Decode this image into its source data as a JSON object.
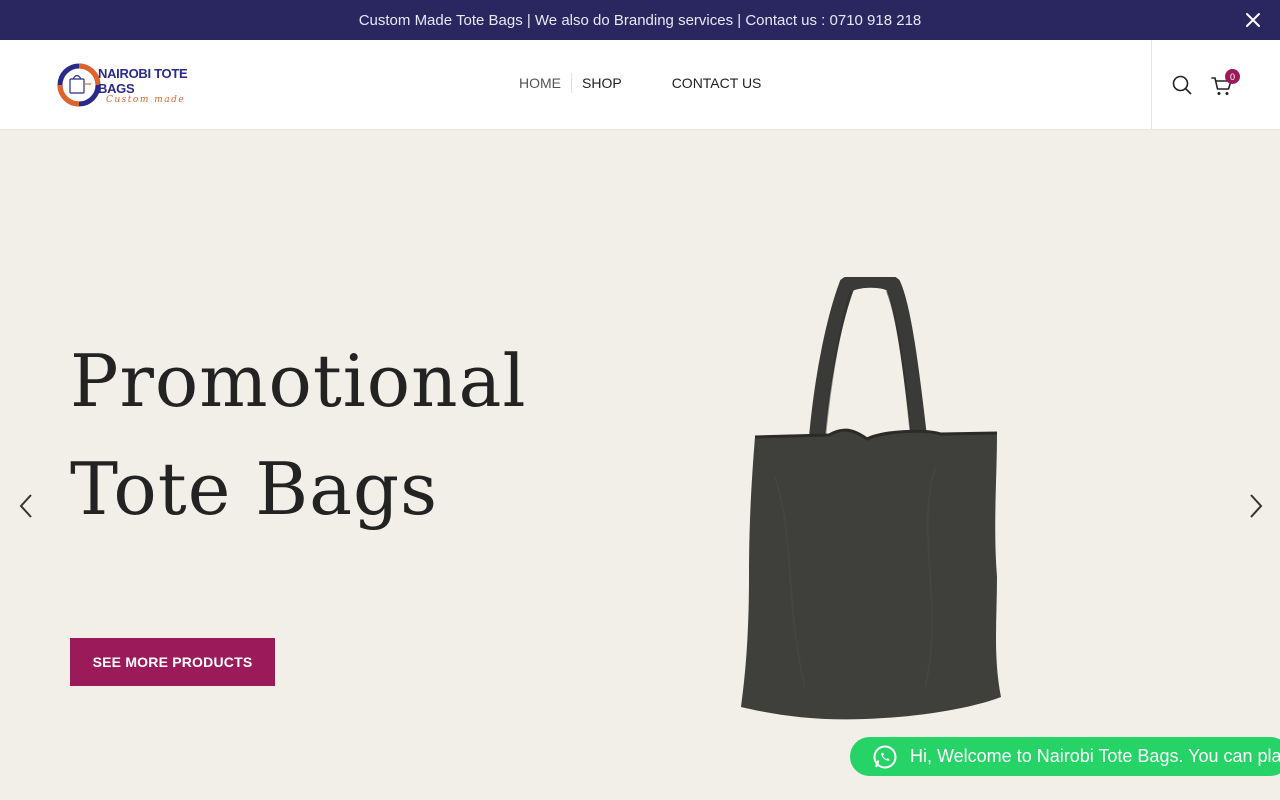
{
  "topbar": {
    "message": "Custom Made Tote Bags  |  We also do Branding services  |  Contact us : 0710 918 218",
    "close_icon": "close-icon"
  },
  "header": {
    "logo": {
      "name": "NAIROBI TOTE BAGS",
      "tagline": "Custom made"
    },
    "nav": [
      {
        "label": "HOME"
      },
      {
        "label": "SHOP"
      },
      {
        "label": "CONTACT US"
      }
    ],
    "search_icon": "search-icon",
    "cart": {
      "icon": "cart-icon",
      "count": "0"
    }
  },
  "hero": {
    "title_line1": "Promotional",
    "title_line2": "Tote Bags",
    "cta_label": "SEE MORE PRODUCTS",
    "prev_icon": "chevron-left-icon",
    "next_icon": "chevron-right-icon"
  },
  "whatsapp": {
    "text": "Hi, Welcome to Nairobi Tote Bags. You can pla",
    "icon": "whatsapp-icon"
  },
  "colors": {
    "topbar_bg": "#2a2660",
    "accent": "#9b1b5a",
    "hero_bg": "#f2eee8",
    "whatsapp": "#25d366"
  }
}
